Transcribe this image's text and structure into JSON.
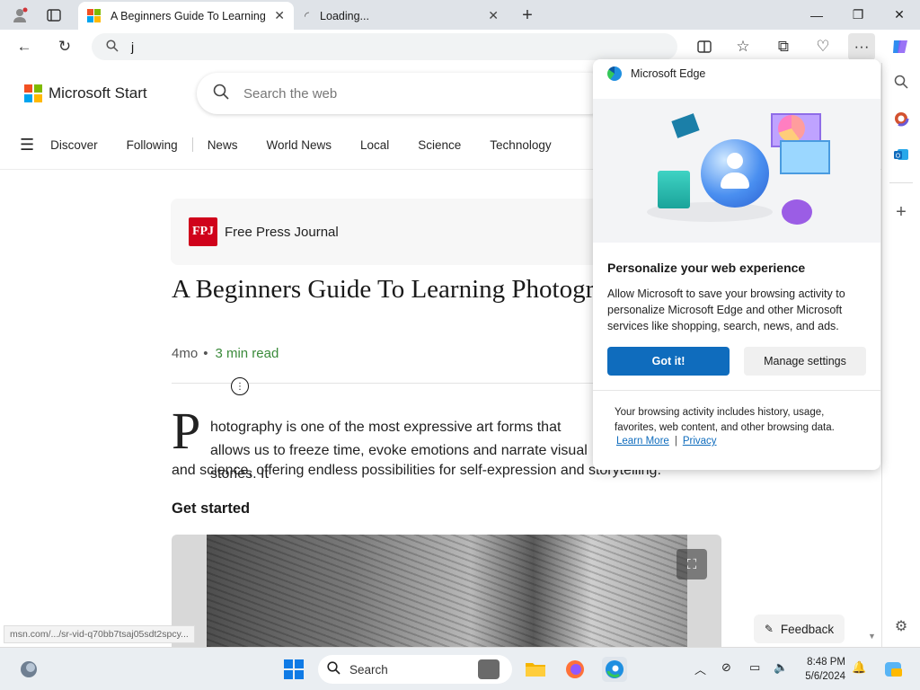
{
  "browser": {
    "tabs": [
      {
        "title": "A Beginners Guide To Learning Photo",
        "active": true
      },
      {
        "title": "Loading...",
        "active": false
      }
    ],
    "address": {
      "value": "j"
    },
    "status_url": "msn.com/.../sr-vid-q70bb7tsaj05sdt2spcy..."
  },
  "site": {
    "brand": "Microsoft Start",
    "search_placeholder": "Search the web",
    "nav": [
      "Discover",
      "Following",
      "News",
      "World News",
      "Local",
      "Science",
      "Technology"
    ]
  },
  "article": {
    "source": "Free Press Journal",
    "source_badge": "FPJ",
    "headline": "A Beginners Guide To Learning Photography",
    "age": "4mo",
    "bullet": "•",
    "read_time": "3 min read",
    "dropcap": "P",
    "para1": "hotography is one of the most expressive art forms that allows us to freeze time, evoke emotions and narrate visual stories. It",
    "para2": "and science, offering endless possibilities for self-expression and storytelling.",
    "subheading": "Get started"
  },
  "feedback": {
    "label": "Feedback"
  },
  "popup": {
    "app_name": "Microsoft Edge",
    "title": "Personalize your web experience",
    "description": "Allow Microsoft to save your browsing activity to personalize Microsoft Edge and other Microsoft services like shopping, search, news, and ads.",
    "primary_button": "Got it!",
    "secondary_button": "Manage settings",
    "footnote": "Your browsing activity includes history, usage, favorites, web content, and other browsing data.",
    "link_learn_more": "Learn More",
    "link_separator": "|",
    "link_privacy": "Privacy"
  },
  "taskbar": {
    "search_label": "Search",
    "time": "8:48 PM",
    "date": "5/6/2024"
  },
  "colors": {
    "accent": "#0f6cbd",
    "read_time": "#3a8a3a",
    "fpj_red": "#d0021b"
  }
}
